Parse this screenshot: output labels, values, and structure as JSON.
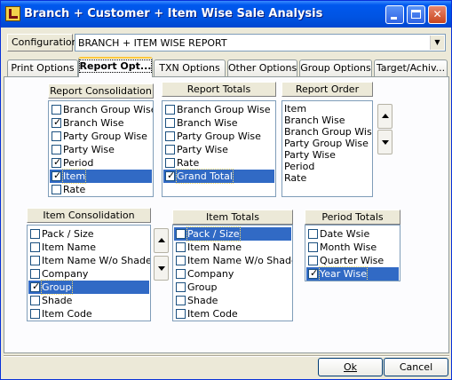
{
  "window": {
    "title": "Branch + Customer + Item Wise Sale Analysis"
  },
  "configuration": {
    "label": "Configuration",
    "value": "BRANCH + ITEM WISE REPORT"
  },
  "tabs": [
    "Print Options",
    "Report Opt...",
    "TXN Options",
    "Other Options",
    "Group Options",
    "Target/Achiv..."
  ],
  "active_tab": "Report Opt...",
  "report_consolidation": {
    "title": "Report Consolidation",
    "items": [
      {
        "label": "Branch Group Wise",
        "checked": false,
        "selected": false
      },
      {
        "label": "Branch Wise",
        "checked": true,
        "selected": false
      },
      {
        "label": "Party Group Wise",
        "checked": false,
        "selected": false
      },
      {
        "label": "Party Wise",
        "checked": false,
        "selected": false
      },
      {
        "label": "Period",
        "checked": true,
        "selected": false
      },
      {
        "label": "Item",
        "checked": true,
        "selected": true
      },
      {
        "label": "Rate",
        "checked": false,
        "selected": false
      }
    ]
  },
  "report_totals": {
    "title": "Report Totals",
    "items": [
      {
        "label": "Branch Group Wise",
        "checked": false,
        "selected": false
      },
      {
        "label": "Branch Wise",
        "checked": false,
        "selected": false
      },
      {
        "label": "Party Group Wise",
        "checked": false,
        "selected": false
      },
      {
        "label": "Party Wise",
        "checked": false,
        "selected": false
      },
      {
        "label": "Rate",
        "checked": false,
        "selected": false
      },
      {
        "label": "Grand Total",
        "checked": true,
        "selected": true
      }
    ]
  },
  "report_order": {
    "title": "Report Order",
    "items": [
      "Item",
      "Branch Wise",
      "Branch Group Wise",
      "Party Group Wise",
      "Party Wise",
      "Period",
      "Rate"
    ]
  },
  "item_consolidation": {
    "title": "Item Consolidation",
    "items": [
      {
        "label": "Pack / Size",
        "checked": false,
        "selected": false
      },
      {
        "label": "Item Name",
        "checked": false,
        "selected": false
      },
      {
        "label": "Item Name W/o Shade",
        "checked": false,
        "selected": false
      },
      {
        "label": "Company",
        "checked": false,
        "selected": false
      },
      {
        "label": "Group",
        "checked": true,
        "selected": true
      },
      {
        "label": "Shade",
        "checked": false,
        "selected": false
      },
      {
        "label": "Item Code",
        "checked": false,
        "selected": false
      }
    ]
  },
  "item_totals": {
    "title": "Item Totals",
    "items": [
      {
        "label": "Pack / Size",
        "checked": false,
        "selected": true
      },
      {
        "label": "Item Name",
        "checked": false,
        "selected": false
      },
      {
        "label": "Item Name W/o Shade",
        "checked": false,
        "selected": false
      },
      {
        "label": "Company",
        "checked": false,
        "selected": false
      },
      {
        "label": "Group",
        "checked": false,
        "selected": false
      },
      {
        "label": "Shade",
        "checked": false,
        "selected": false
      },
      {
        "label": "Item Code",
        "checked": false,
        "selected": false
      }
    ]
  },
  "period_totals": {
    "title": "Period Totals",
    "items": [
      {
        "label": "Date Wsie",
        "checked": false,
        "selected": false
      },
      {
        "label": "Month Wise",
        "checked": false,
        "selected": false
      },
      {
        "label": "Quarter Wise",
        "checked": false,
        "selected": false
      },
      {
        "label": "Year Wise",
        "checked": true,
        "selected": true
      }
    ]
  },
  "buttons": {
    "ok": "Ok",
    "cancel": "Cancel"
  },
  "colors": {
    "titlebar": "#0054E3",
    "selection": "#316AC5",
    "face": "#ECE9D8"
  }
}
